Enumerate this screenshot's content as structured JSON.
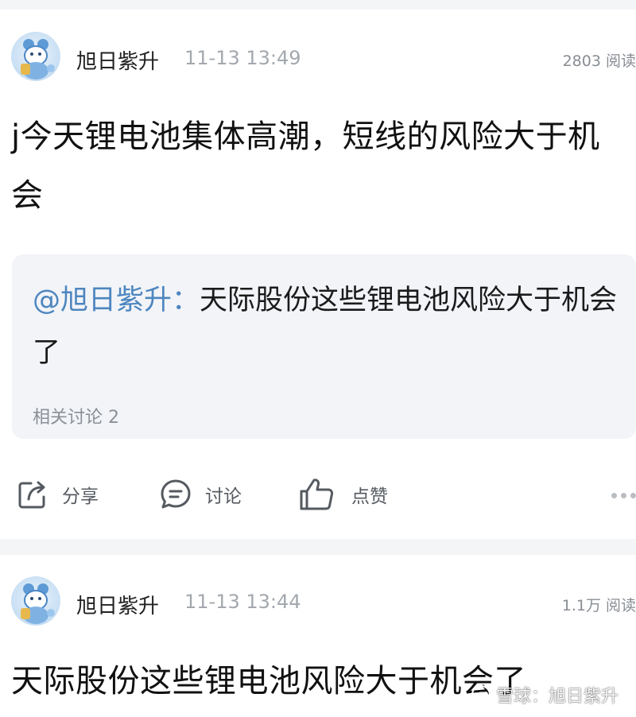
{
  "posts": [
    {
      "author": "旭日紫升",
      "time": "11-13 13:49",
      "reads": "2803 阅读",
      "text": "j今天锂电池集体高潮，短线的风险大于机会",
      "quote": {
        "author": "@旭日紫升：",
        "text": "天际股份这些锂电池风险大于机会了",
        "related": "相关讨论 2"
      },
      "actions": {
        "share": "分享",
        "discuss": "讨论",
        "like": "点赞"
      }
    },
    {
      "author": "旭日紫升",
      "time": "11-13 13:44",
      "reads": "1.1万 阅读",
      "text": "天际股份这些锂电池风险大于机会了"
    }
  ],
  "watermark": "雪球：旭日紫升",
  "icons": {
    "avatar": "avatar-icon",
    "share": "share-icon",
    "discuss": "comment-icon",
    "like": "thumbs-up-icon",
    "more": "more-icon"
  },
  "colors": {
    "link": "#4d86bf",
    "muted": "#a3a8ae",
    "quote_bg": "#f2f4f8"
  }
}
